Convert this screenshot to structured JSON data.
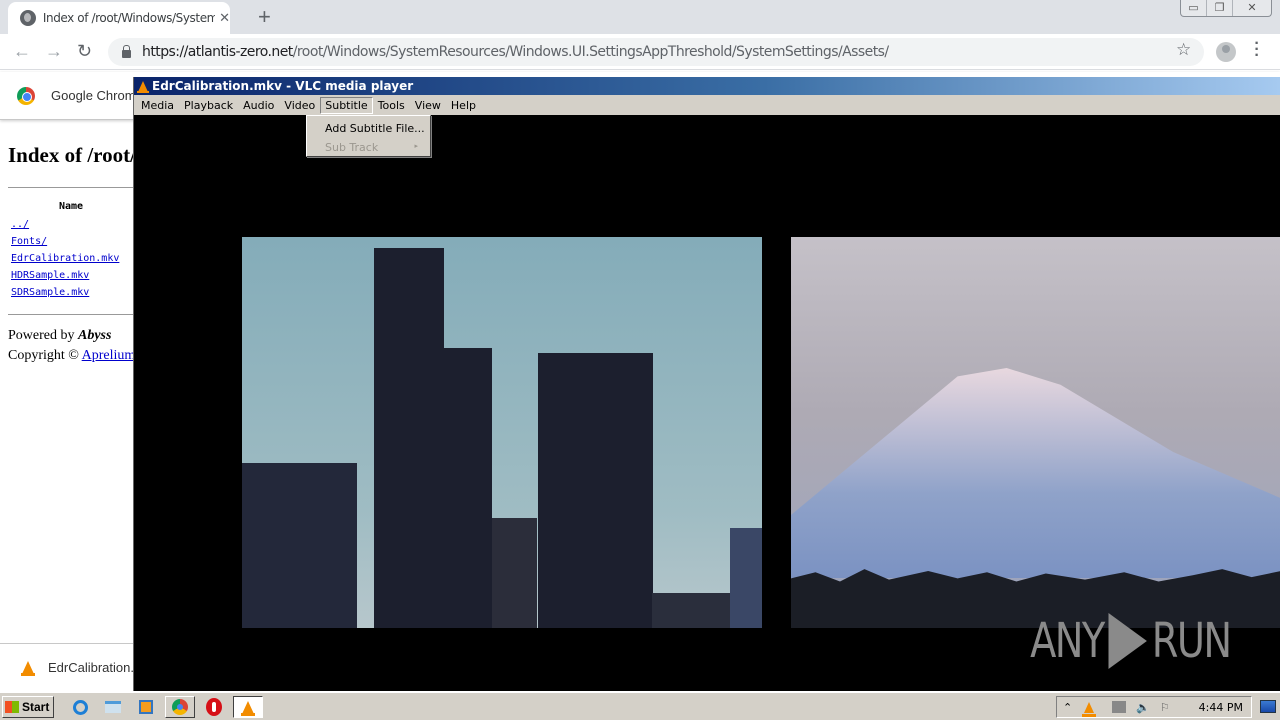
{
  "browser": {
    "tab_title": "Index of /root/Windows/SystemResources",
    "tab_close": "✕",
    "new_tab": "+",
    "window_controls": {
      "minimize": "▭",
      "restore": "❐",
      "close": "✕"
    },
    "nav": {
      "back": "←",
      "forward": "→",
      "reload": "↻"
    },
    "url_host": "https://atlantis-zero.net",
    "url_path": "/root/Windows/SystemResources/Windows.UI.SettingsAppThreshold/SystemSettings/Assets/",
    "bookmark_icon": "☆",
    "menu_icon": "⋮"
  },
  "infobar": {
    "label": "Google Chrome"
  },
  "page": {
    "heading": "Index of /root/Windows/SystemResources/Windows.UI.SettingsAppThreshold/SystemSettings/Assets/",
    "column_header": "Name",
    "files": [
      "../",
      "Fonts/",
      "EdrCalibration.mkv",
      "HDRSample.mkv",
      "SDRSample.mkv"
    ],
    "powered_by_prefix": "Powered by ",
    "powered_by_name": "Abyss",
    "copyright_prefix": "Copyright © ",
    "copyright_link": "Aprelium"
  },
  "download": {
    "filename": "EdrCalibration.mkv"
  },
  "vlc": {
    "title": "EdrCalibration.mkv - VLC media player",
    "menu": [
      "Media",
      "Playback",
      "Audio",
      "Video",
      "Subtitle",
      "Tools",
      "View",
      "Help"
    ],
    "active_menu": "Subtitle",
    "dropdown": [
      {
        "label": "Add Subtitle File...",
        "enabled": true
      },
      {
        "label": "Sub Track",
        "enabled": false,
        "submenu_arrow": "▸"
      }
    ]
  },
  "watermark": {
    "left": "ANY",
    "right": "RUN"
  },
  "taskbar": {
    "start_label": "Start",
    "clock": "4:44 PM",
    "tray_chevron": "⌃"
  }
}
